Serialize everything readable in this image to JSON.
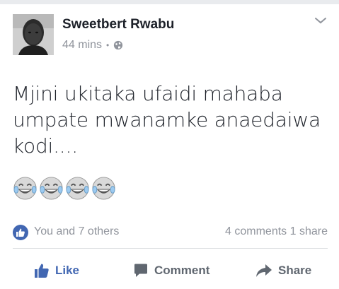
{
  "post": {
    "author": "Sweetbert Rwabu",
    "time": "44 mins",
    "separator": "•",
    "privacy_icon": "globe-icon",
    "menu_icon": "chevron-down-icon",
    "text": "Mjini ukitaka ufaidi mahaba umpate mwanamke anaedaiwa kodi....",
    "emojis": [
      "tears-of-joy-emoji",
      "tears-of-joy-emoji",
      "tears-of-joy-emoji",
      "tears-of-joy-emoji"
    ]
  },
  "stats": {
    "likes_text": "You and 7 others",
    "comments_text": "4 comments",
    "shares_text": "1 share"
  },
  "actions": {
    "like_label": "Like",
    "comment_label": "Comment",
    "share_label": "Share"
  },
  "colors": {
    "accent": "#4267b2",
    "meta_text": "#90949c",
    "action_text": "#606770",
    "divider": "#dddfe2"
  }
}
